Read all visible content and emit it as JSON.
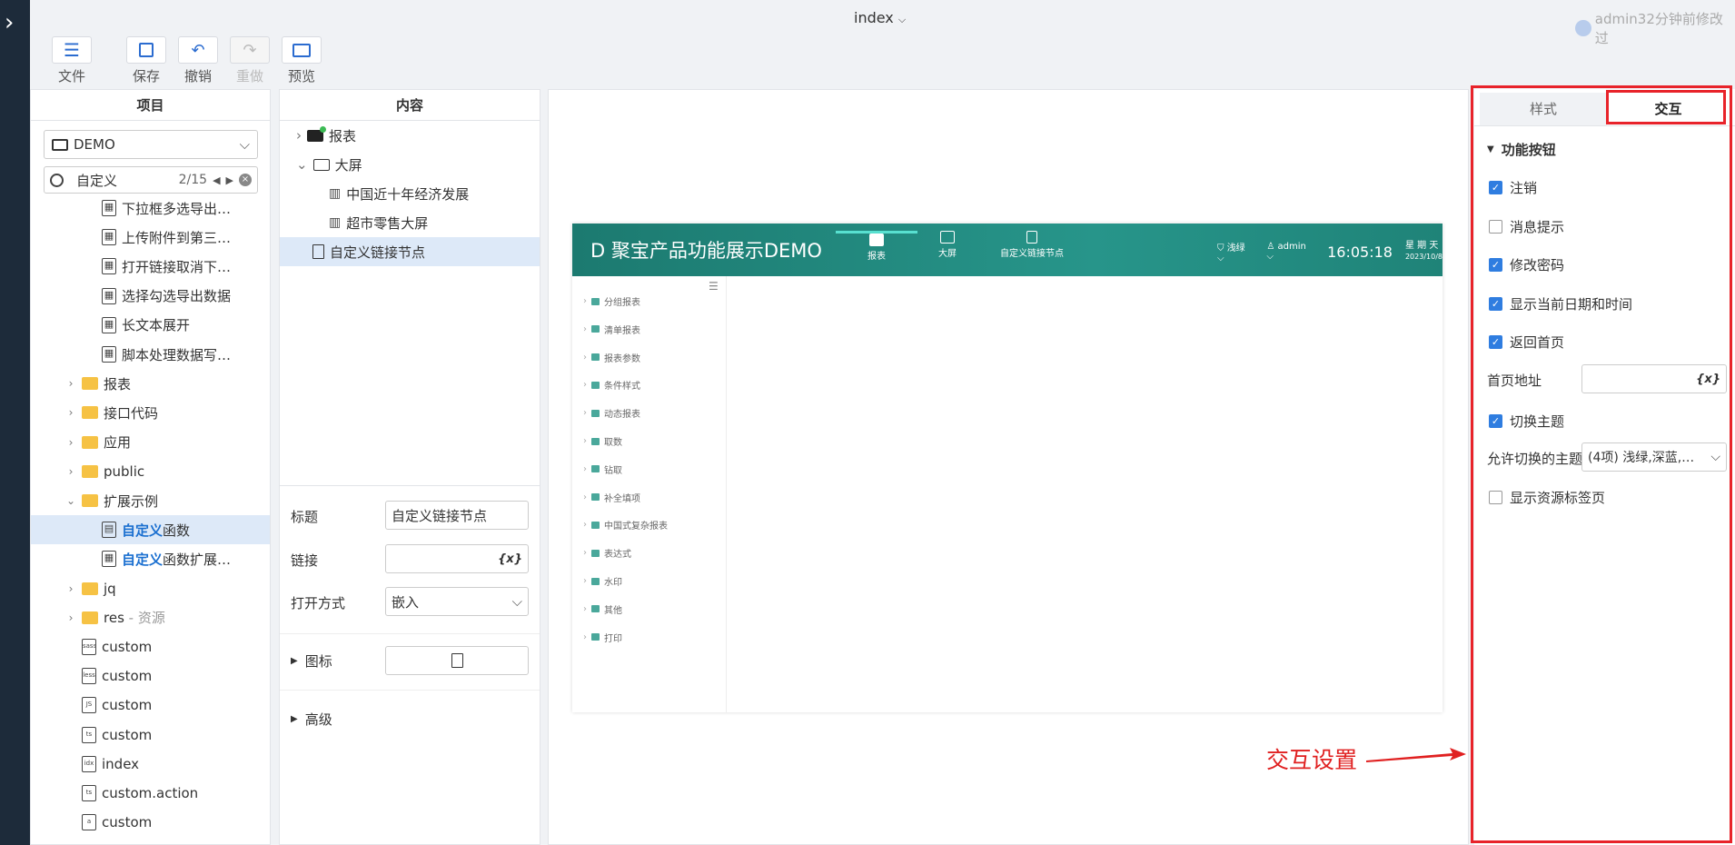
{
  "window": {
    "title": "index",
    "user_status": "admin32分钟前修改过"
  },
  "toolbar": {
    "file": "文件",
    "save": "保存",
    "undo": "撤销",
    "redo": "重做",
    "preview": "预览"
  },
  "project_panel": {
    "header": "项目",
    "project": "DEMO",
    "search": {
      "value": "自定义",
      "count": "2/15"
    },
    "tree": [
      {
        "label": "下拉框多选导出…",
        "type": "report",
        "indent": 3
      },
      {
        "label": "上传附件到第三…",
        "type": "report",
        "indent": 3
      },
      {
        "label": "打开链接取消下…",
        "type": "report",
        "indent": 3
      },
      {
        "label": "选择勾选导出数据",
        "type": "report",
        "indent": 3
      },
      {
        "label": "长文本展开",
        "type": "report",
        "indent": 3
      },
      {
        "label": "脚本处理数据写…",
        "type": "report",
        "indent": 3
      },
      {
        "label": "报表",
        "type": "folder",
        "indent": 2,
        "arrow": "›"
      },
      {
        "label": "接口代码",
        "type": "folder",
        "indent": 2,
        "arrow": "›"
      },
      {
        "label": "应用",
        "type": "folder",
        "indent": 2,
        "arrow": "›"
      },
      {
        "label": "public",
        "type": "folder",
        "indent": 2,
        "arrow": "›"
      },
      {
        "label": "扩展示例",
        "type": "folder",
        "indent": 2,
        "arrow": "⌄"
      },
      {
        "label": "函数",
        "hl": "自定义",
        "type": "table",
        "indent": 3,
        "selected": true
      },
      {
        "label": "函数扩展…",
        "hl": "自定义",
        "type": "report",
        "indent": 3
      },
      {
        "label": "jq",
        "type": "folder",
        "indent": 2,
        "arrow": "›"
      },
      {
        "label": "res",
        "muted": " - 资源",
        "type": "folder",
        "indent": 2,
        "arrow": "›"
      },
      {
        "label": "custom",
        "type": "file",
        "ext": "sass",
        "indent": 2
      },
      {
        "label": "custom",
        "type": "file",
        "ext": "less",
        "indent": 2
      },
      {
        "label": "custom",
        "type": "file",
        "ext": "JS",
        "indent": 2
      },
      {
        "label": "custom",
        "type": "file",
        "ext": "ts",
        "indent": 2
      },
      {
        "label": "index",
        "type": "file",
        "ext": "idx",
        "indent": 2
      },
      {
        "label": "custom.action",
        "type": "file",
        "ext": "ts",
        "indent": 2
      },
      {
        "label": "custom",
        "type": "file",
        "ext": "a",
        "indent": 2
      }
    ]
  },
  "content_panel": {
    "header": "内容",
    "tree": [
      {
        "label": "报表",
        "arrow": "›"
      },
      {
        "label": "大屏",
        "arrow": "⌄"
      },
      {
        "label": "中国近十年经济发展"
      },
      {
        "label": "超市零售大屏"
      },
      {
        "label": "自定义链接节点",
        "selected": true
      }
    ],
    "props": {
      "title_label": "标题",
      "title_value": "自定义链接节点",
      "link_label": "链接",
      "link_value": "",
      "open_label": "打开方式",
      "open_value": "嵌入",
      "icon_label": "图标",
      "advanced_label": "高级",
      "fx": "{x}"
    }
  },
  "preview": {
    "title": "D 聚宝产品功能展示DEMO",
    "nav": [
      "报表",
      "大屏",
      "自定义链接节点"
    ],
    "theme": "浅绿",
    "user": "admin",
    "time": "16:05:18",
    "weekday": "星 期 天",
    "date": "2023/10/8",
    "menu": [
      "分组报表",
      "清单报表",
      "报表参数",
      "条件样式",
      "动态报表",
      "取数",
      "钻取",
      "补全填项",
      "中国式复杂报表",
      "表达式",
      "水印",
      "其他",
      "打印"
    ]
  },
  "annotation": {
    "text": "交互设置",
    "color": "#e02020"
  },
  "right_panel": {
    "tabs": [
      "样式",
      "交互"
    ],
    "section": "功能按钮",
    "options": [
      {
        "label": "注销",
        "checked": true
      },
      {
        "label": "消息提示",
        "checked": false
      },
      {
        "label": "修改密码",
        "checked": true
      },
      {
        "label": "显示当前日期和时间",
        "checked": true
      },
      {
        "label": "返回首页",
        "checked": true
      }
    ],
    "home_label": "首页地址",
    "home_value": "",
    "switch_theme": {
      "label": "切换主题",
      "checked": true
    },
    "allowed_label": "允许切换的主题",
    "allowed_value": "(4项) 浅绿,深蓝,…",
    "show_tabs": {
      "label": "显示资源标签页",
      "checked": false
    },
    "fx": "{x}"
  },
  "colors": {
    "accent": "#2f7de0",
    "highlight_box": "#e8232a",
    "preview_header": "#1f8378",
    "sidebar": "#1d2b3a"
  }
}
